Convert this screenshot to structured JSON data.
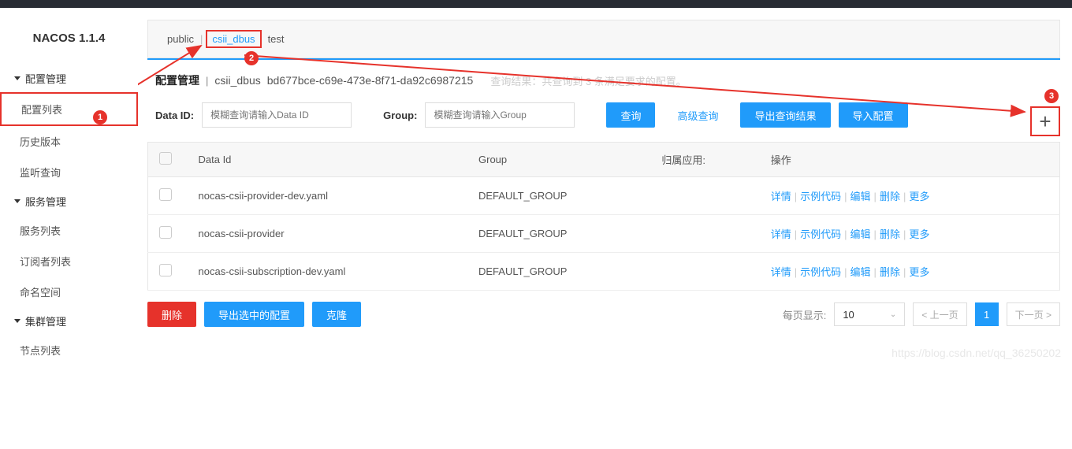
{
  "logo": "NACOS 1.1.4",
  "nav": {
    "groups": [
      {
        "title": "配置管理",
        "items": [
          "配置列表",
          "历史版本",
          "监听查询"
        ]
      },
      {
        "title": "服务管理",
        "items": [
          "服务列表",
          "订阅者列表",
          "命名空间"
        ]
      },
      {
        "title": "集群管理",
        "items": [
          "节点列表"
        ]
      }
    ]
  },
  "namespaces": {
    "tabs": [
      "public",
      "csii_dbus",
      "test"
    ],
    "active": "csii_dbus"
  },
  "breadcrumb": {
    "title": "配置管理",
    "ns": "csii_dbus",
    "uuid": "bd677bce-c69e-473e-8f71-da92c6987215",
    "hint": "查询结果：共查询到 3 条满足要求的配置。"
  },
  "search": {
    "dataid_label": "Data ID:",
    "dataid_placeholder": "模糊查询请输入Data ID",
    "group_label": "Group:",
    "group_placeholder": "模糊查询请输入Group",
    "query_btn": "查询",
    "adv_query": "高级查询",
    "export_btn": "导出查询结果",
    "import_btn": "导入配置"
  },
  "table": {
    "headers": {
      "dataid": "Data Id",
      "group": "Group",
      "app": "归属应用:",
      "ops": "操作"
    },
    "rows": [
      {
        "dataid": "nocas-csii-provider-dev.yaml",
        "group": "DEFAULT_GROUP",
        "app": ""
      },
      {
        "dataid": "nocas-csii-provider",
        "group": "DEFAULT_GROUP",
        "app": ""
      },
      {
        "dataid": "nocas-csii-subscription-dev.yaml",
        "group": "DEFAULT_GROUP",
        "app": ""
      }
    ],
    "ops": {
      "detail": "详情",
      "sample": "示例代码",
      "edit": "编辑",
      "delete": "删除",
      "more": "更多"
    }
  },
  "footer": {
    "delete_btn": "删除",
    "export_selected": "导出选中的配置",
    "clone_btn": "克隆",
    "page_size_label": "每页显示:",
    "page_size_value": "10",
    "prev": "< 上一页",
    "current": "1",
    "next": "下一页 >"
  },
  "annotations": {
    "b1": "1",
    "b2": "2",
    "b3": "3"
  },
  "watermark": "https://blog.csdn.net/qq_36250202"
}
